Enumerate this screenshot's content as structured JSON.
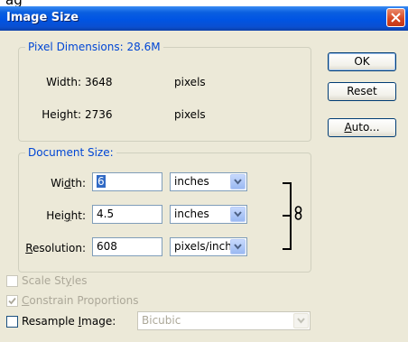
{
  "window": {
    "title": "Image Size"
  },
  "pixel_dimensions": {
    "legend": "Pixel Dimensions:",
    "size": "28.6M",
    "width_label": "Width:",
    "width_value": "3648",
    "width_unit": "pixels",
    "height_label": "Height:",
    "height_value": "2736",
    "height_unit": "pixels"
  },
  "document_size": {
    "legend": "Document Size:",
    "width_label": "Width:",
    "width_value": "6",
    "width_unit": "inches",
    "height_label": "Height:",
    "height_value": "4.5",
    "height_unit": "inches",
    "resolution_label": "Resolution:",
    "resolution_value": "608",
    "resolution_unit": "pixels/inch"
  },
  "buttons": {
    "ok": "OK",
    "reset": "Reset",
    "auto": "Auto..."
  },
  "options": {
    "scale_styles": {
      "label": "Scale Styles",
      "checked": false,
      "enabled": false
    },
    "constrain_proportions": {
      "label": "Constrain Proportions",
      "checked": true,
      "enabled": false
    },
    "resample_image": {
      "label": "Resample Image:",
      "checked": false,
      "enabled": true,
      "method": "Bicubic"
    }
  },
  "colors": {
    "title_bar": "#0054e3",
    "group_legend": "#0046d5",
    "dialog_bg": "#ece9d8",
    "close_button": "#d6451f"
  }
}
